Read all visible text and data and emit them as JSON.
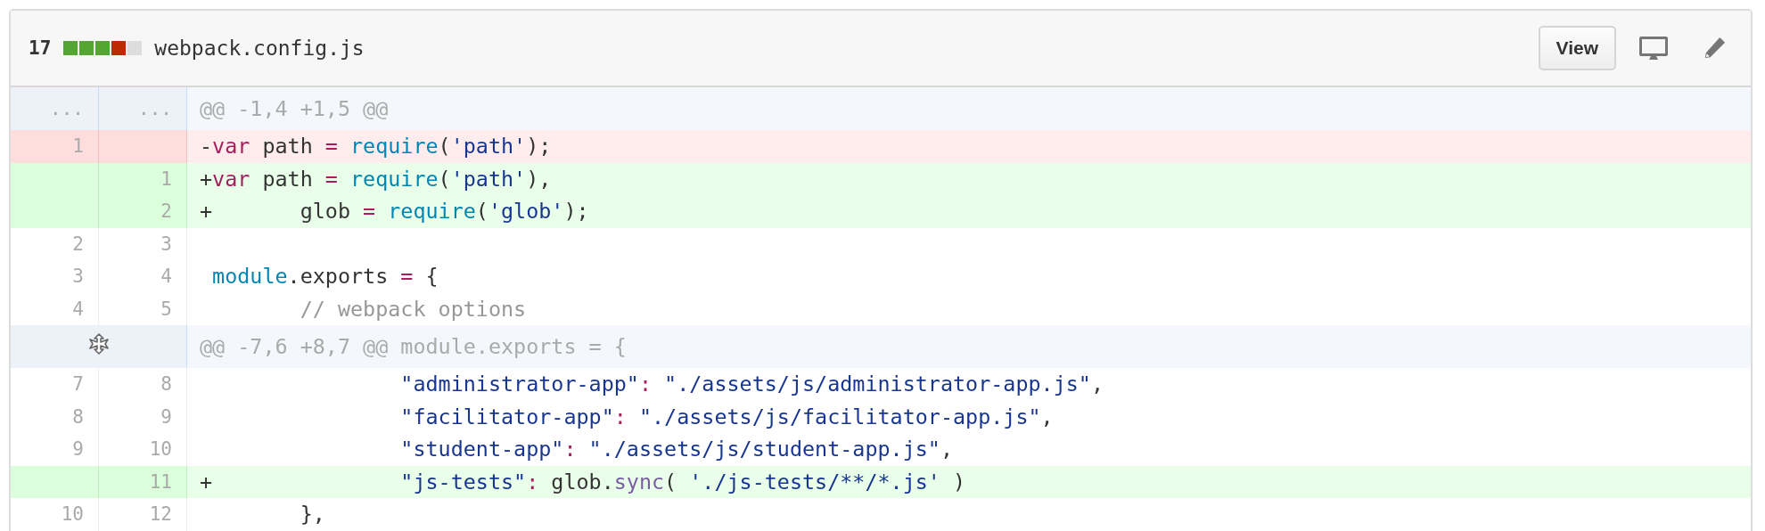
{
  "file": {
    "changes": "17",
    "diffstat": [
      {
        "kind": "added"
      },
      {
        "kind": "added"
      },
      {
        "kind": "added"
      },
      {
        "kind": "deleted"
      },
      {
        "kind": "neutral"
      }
    ],
    "name": "webpack.config.js",
    "view_button": "View"
  },
  "rows": [
    {
      "kind": "hunk",
      "expandable": false,
      "old": "...",
      "new": "...",
      "text": "@@ -1,4 +1,5 @@"
    },
    {
      "kind": "deleted",
      "old": "1",
      "code": "-var path = require('path');"
    },
    {
      "kind": "added",
      "new": "1",
      "code": "+var path = require('path'),"
    },
    {
      "kind": "added",
      "new": "2",
      "code": "+\tglob = require('glob');"
    },
    {
      "kind": "context",
      "old": "2",
      "new": "3"
    },
    {
      "kind": "context",
      "old": "3",
      "new": "4",
      "code": " module.exports = {"
    },
    {
      "kind": "context",
      "old": "4",
      "new": "5",
      "code": " \t// webpack options"
    },
    {
      "kind": "hunk",
      "expandable": true,
      "text": "@@ -7,6 +8,7 @@ module.exports = {"
    },
    {
      "kind": "context",
      "old": "7",
      "new": "8",
      "code": " \t\t\"administrator-app\": \"./assets/js/administrator-app.js\","
    },
    {
      "kind": "context",
      "old": "8",
      "new": "9",
      "code": " \t\t\"facilitator-app\": \"./assets/js/facilitator-app.js\","
    },
    {
      "kind": "context",
      "old": "9",
      "new": "10",
      "code": " \t\t\"student-app\": \"./assets/js/student-app.js\","
    },
    {
      "kind": "added",
      "new": "11",
      "code": "+\t\t\"js-tests\": glob.sync( './js-tests/**/*.js' )"
    },
    {
      "kind": "context",
      "old": "10",
      "new": "12",
      "code": " \t},"
    }
  ]
}
